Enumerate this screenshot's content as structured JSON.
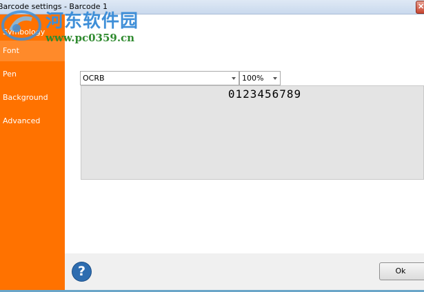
{
  "window": {
    "title": "Barcode settings - Barcode 1"
  },
  "sidebar": {
    "items": [
      {
        "label": "Symbology"
      },
      {
        "label": "Font"
      },
      {
        "label": "Pen"
      },
      {
        "label": "Background"
      },
      {
        "label": "Advanced"
      }
    ]
  },
  "watermark": {
    "title": "河东软件园",
    "url": "www.pc0359.cn"
  },
  "font_settings": {
    "font_name": "OCRB",
    "zoom": "100%",
    "preview_text": "0123456789"
  },
  "footer": {
    "ok_label": "Ok",
    "help_icon": "?"
  },
  "colors": {
    "sidebar": "#ff7200",
    "preview_bg": "#e4e4e4",
    "help_blue": "#2e6db0"
  }
}
